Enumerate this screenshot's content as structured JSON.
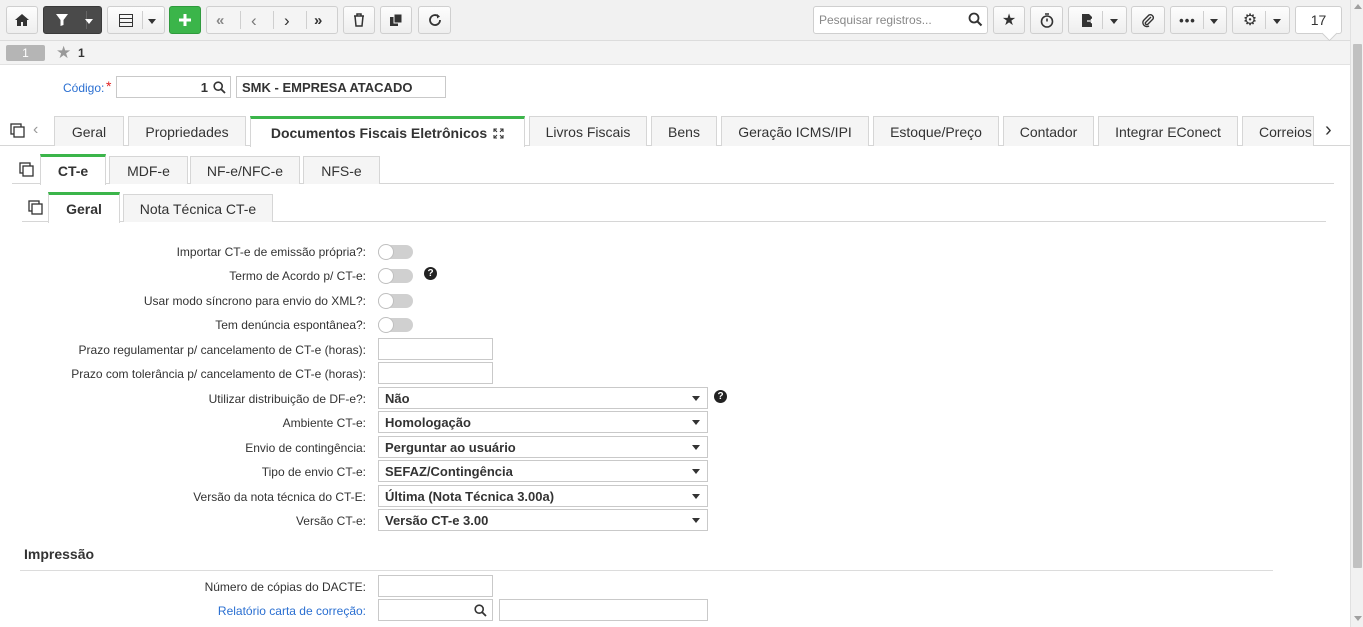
{
  "toolbar": {
    "search_placeholder": "Pesquisar registros...",
    "record_count": "17"
  },
  "record": {
    "number": "1",
    "id": "1"
  },
  "header": {
    "codigo_label": "Código:",
    "codigo_value": "1",
    "empresa_value": "SMK - EMPRESA ATACADO"
  },
  "main_tabs": [
    "Geral",
    "Propriedades",
    "Documentos Fiscais Eletrônicos",
    "Livros Fiscais",
    "Bens",
    "Geração ICMS/IPI",
    "Estoque/Preço",
    "Contador",
    "Integrar EConect",
    "Correios"
  ],
  "sub_tabs": [
    "CT-e",
    "MDF-e",
    "NF-e/NFC-e",
    "NFS-e"
  ],
  "sub2_tabs": [
    "Geral",
    "Nota Técnica CT-e"
  ],
  "form": {
    "importar_label": "Importar CT-e de emissão própria?:",
    "termo_label": "Termo de Acordo p/ CT-e:",
    "sincrono_label": "Usar modo síncrono para envio do XML?:",
    "denuncia_label": "Tem denúncia espontânea?:",
    "prazo_reg_label": "Prazo regulamentar p/ cancelamento de CT-e (horas):",
    "prazo_tol_label": "Prazo com tolerância p/ cancelamento de CT-e (horas):",
    "dist_label": "Utilizar distribuição de DF-e?:",
    "dist_value": "Não",
    "ambiente_label": "Ambiente CT-e:",
    "ambiente_value": "Homologação",
    "contingencia_label": "Envio de contingência:",
    "contingencia_value": "Perguntar ao usuário",
    "tipo_label": "Tipo de envio CT-e:",
    "tipo_value": "SEFAZ/Contingência",
    "versao_nt_label": "Versão da nota técnica do CT-E:",
    "versao_nt_value": "Última (Nota Técnica 3.00a)",
    "versao_label": "Versão CT-e:",
    "versao_value": "Versão CT-e 3.00"
  },
  "impressao": {
    "title": "Impressão",
    "copias_label": "Número de cópias do DACTE:",
    "relatorio_label": "Relatório carta de correção:"
  },
  "colors": {
    "accent": "#3bb54a",
    "link": "#2a6fd1",
    "required": "#e02020"
  }
}
